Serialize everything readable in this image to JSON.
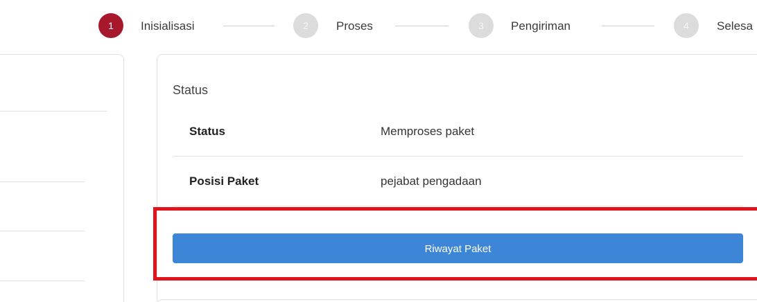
{
  "stepper": {
    "steps": [
      {
        "number": "1",
        "label": "Inisialisasi",
        "state": "active"
      },
      {
        "number": "2",
        "label": "Proses",
        "state": "inactive"
      },
      {
        "number": "3",
        "label": "Pengiriman",
        "state": "inactive"
      },
      {
        "number": "4",
        "label": "Selesa",
        "state": "inactive"
      }
    ]
  },
  "status_card": {
    "title": "Status",
    "rows": [
      {
        "label": "Status",
        "value": "Memproses paket"
      },
      {
        "label": "Posisi Paket",
        "value": "pejabat pengadaan"
      }
    ],
    "history_button_label": "Riwayat Paket"
  },
  "colors": {
    "active_step": "#a7182c",
    "inactive_step": "#dcdcdc",
    "button": "#3d85d6",
    "highlight_box": "#e1141e"
  }
}
